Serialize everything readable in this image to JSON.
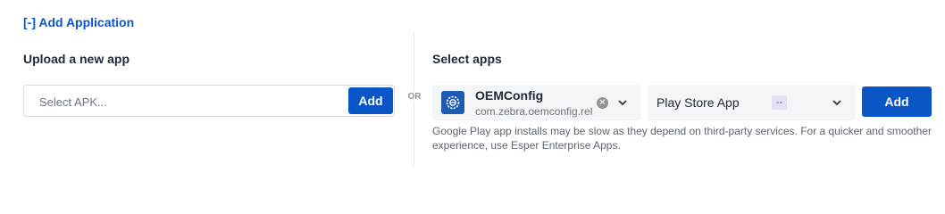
{
  "header": {
    "toggle_label": "[-] Add Application"
  },
  "upload": {
    "title": "Upload a new app",
    "placeholder": "Select APK...",
    "add_label": "Add"
  },
  "separator": {
    "or_label": "OR"
  },
  "select_apps": {
    "title": "Select apps",
    "selected_app": {
      "name": "OEMConfig",
      "package": "com.zebra.oemconfig.release",
      "icon": "oemconfig-app-icon"
    },
    "clear_icon": "x-circle-icon",
    "dropdown_icon": "chevron-down-icon",
    "store": {
      "value": "Play Store App",
      "badge": "--"
    },
    "add_label": "Add",
    "note": "Google Play app installs may be slow as they depend on third-party services. For a quicker and smoother experience, use Esper Enterprise Apps."
  },
  "colors": {
    "primary": "#0b56c6",
    "badge_bg": "#e4e1f6",
    "badge_text": "#5a4fc4",
    "select_bg": "#f3f5f7"
  }
}
